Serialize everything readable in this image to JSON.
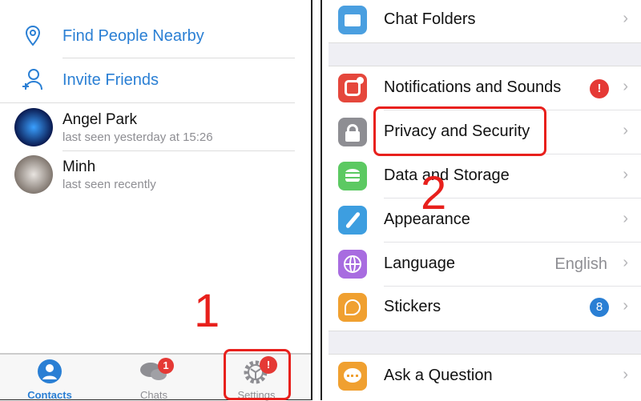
{
  "left": {
    "actions": [
      {
        "label": "Find People Nearby",
        "icon": "location-pin-icon"
      },
      {
        "label": "Invite Friends",
        "icon": "add-person-icon"
      }
    ],
    "contacts": [
      {
        "name": "Angel Park",
        "status": "last seen yesterday at 15:26"
      },
      {
        "name": "Minh",
        "status": "last seen recently"
      }
    ],
    "tabs": [
      {
        "label": "Contacts",
        "active": true
      },
      {
        "label": "Chats",
        "badge": "1"
      },
      {
        "label": "Settings",
        "badge": "!"
      }
    ],
    "annotation": "1"
  },
  "right": {
    "items": [
      {
        "label": "Chat Folders",
        "color": "#4a9fe0"
      },
      {
        "label": "Notifications and Sounds",
        "color": "#e5473c",
        "badge": "!"
      },
      {
        "label": "Privacy and Security",
        "color": "#8e8e93"
      },
      {
        "label": "Data and Storage",
        "color": "#5cc962"
      },
      {
        "label": "Appearance",
        "color": "#3d9ee0"
      },
      {
        "label": "Language",
        "color": "#a86ce0",
        "value": "English"
      },
      {
        "label": "Stickers",
        "color": "#f0a030",
        "badge": "8"
      },
      {
        "label": "Ask a Question",
        "color": "#f0a030"
      }
    ],
    "annotation": "2"
  },
  "colors": {
    "accent": "#2a7fd4",
    "highlight": "#e8201c",
    "badge": "#e53935"
  }
}
